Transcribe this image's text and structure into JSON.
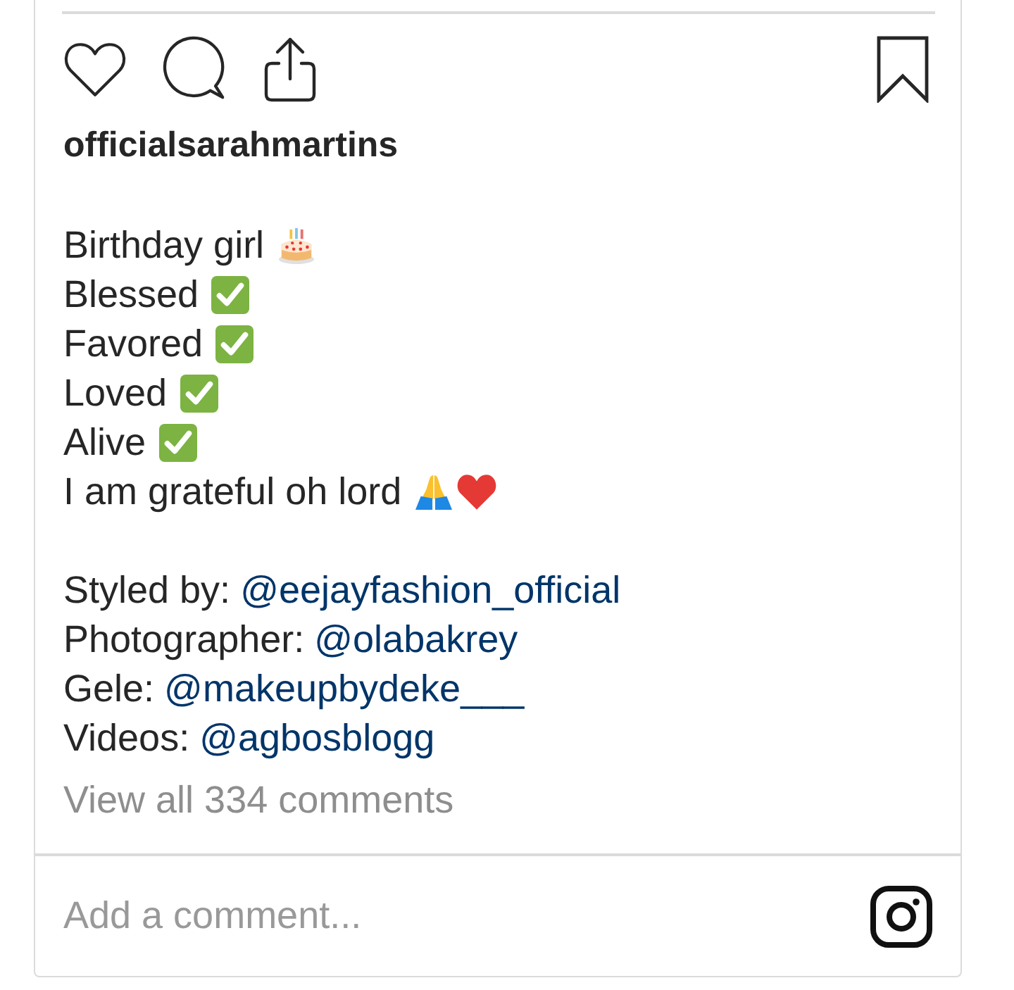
{
  "post": {
    "liked": false,
    "saved": false,
    "username": "officialsarahmartins",
    "caption": [
      {
        "text": "Birthday girl",
        "emojis": [
          {
            "kind": "cake"
          }
        ]
      },
      {
        "text": "Blessed",
        "emojis": [
          {
            "kind": "check"
          }
        ]
      },
      {
        "text": "Favored",
        "emojis": [
          {
            "kind": "check"
          }
        ]
      },
      {
        "text": "Loved",
        "emojis": [
          {
            "kind": "check"
          }
        ]
      },
      {
        "text": "Alive",
        "emojis": [
          {
            "kind": "check"
          }
        ]
      },
      {
        "text": "I am grateful oh lord",
        "emojis": [
          {
            "kind": "pray"
          },
          {
            "kind": "heart"
          }
        ]
      }
    ],
    "credits": [
      {
        "label": "Styled by:",
        "handle": "@eejayfashion_official"
      },
      {
        "label": "Photographer:",
        "handle": "@olabakrey"
      },
      {
        "label": "Gele:",
        "handle": "@makeupbydeke___"
      },
      {
        "label": "Videos:",
        "handle": "@agbosblogg"
      }
    ],
    "view_comments": "View all 334 comments",
    "comment_field": {
      "placeholder": "Add a comment..."
    }
  }
}
